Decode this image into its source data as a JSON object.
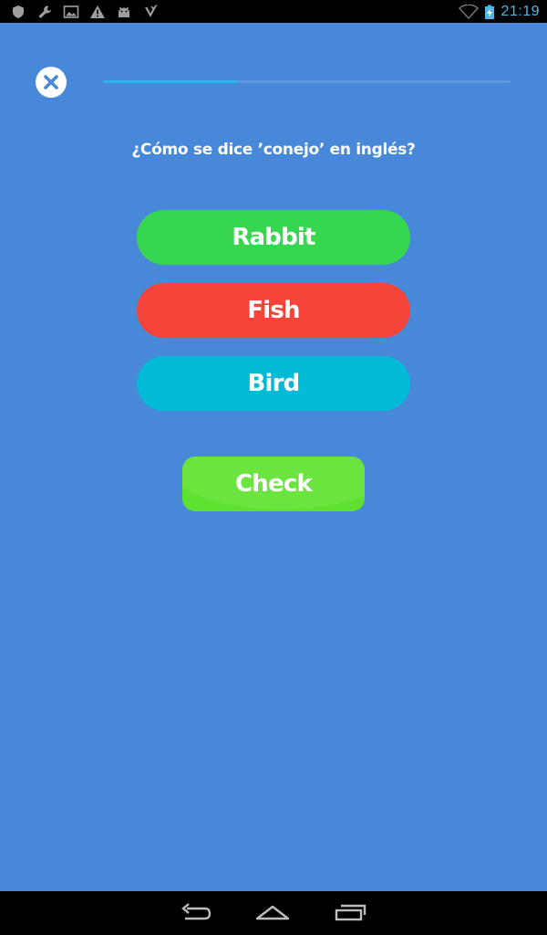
{
  "status_bar": {
    "left_icons": [
      "shield-icon",
      "wrench-icon",
      "image-icon",
      "warning-icon",
      "android-icon",
      "download-check-icon"
    ],
    "right_icons": [
      "wifi-icon",
      "battery-charging-icon"
    ],
    "time": "21:19"
  },
  "quiz": {
    "progress": 0.33,
    "question": "¿Cómo se dice ’conejo’ en inglés?",
    "answers": [
      {
        "label": "Rabbit",
        "color": "#37d64f"
      },
      {
        "label": "Fish",
        "color": "#f5443a"
      },
      {
        "label": "Bird",
        "color": "#00bad6"
      }
    ],
    "check_label": "Check",
    "check_color": "#5fe22f"
  },
  "colors": {
    "background": "#4788d9",
    "progress_fill": "#2fb3ec",
    "close_icon": "#4788d9"
  },
  "nav_bar": {
    "buttons": [
      "back-icon",
      "home-icon",
      "recents-icon"
    ]
  }
}
